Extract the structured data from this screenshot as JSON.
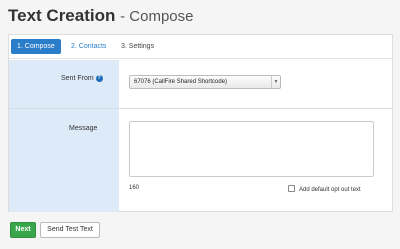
{
  "header": {
    "title": "Text Creation",
    "subtitle": "- Compose"
  },
  "tabs": [
    {
      "label": "1. Compose"
    },
    {
      "label": "2. Contacts"
    },
    {
      "label": "3. Settings"
    }
  ],
  "form": {
    "sent_from_label": "Sent From",
    "help_glyph": "?",
    "sent_from_value": "67076 (CallFire Shared Shortcode)",
    "message_label": "Message",
    "message_value": "",
    "char_count": "160",
    "optout_label": "Add default opt out text",
    "optout_checked": false
  },
  "buttons": {
    "next_label": "Next",
    "send_test_label": "Send Test Text"
  },
  "colors": {
    "accent": "#2a7dc9",
    "label_column": "#ddeaf8",
    "next_button": "#3aa64b"
  }
}
